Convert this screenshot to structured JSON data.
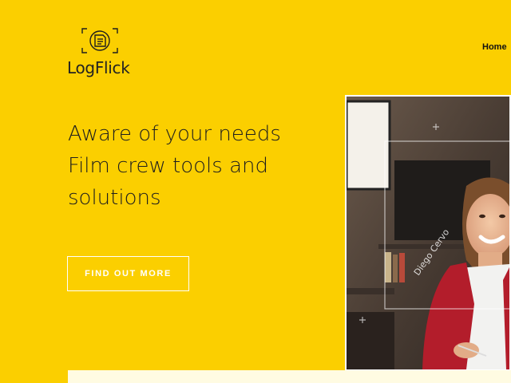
{
  "brand": {
    "name": "LogFlick",
    "logo_icon": "camera-document-icon"
  },
  "nav": {
    "items": [
      {
        "label": "Home"
      }
    ]
  },
  "hero": {
    "lines": [
      "Aware of your needs",
      "Film crew tools and",
      "solutions"
    ],
    "cta_label": "FIND OUT MORE",
    "image": {
      "watermark": "Diego Cervo",
      "subject": "smiling woman in red blazer in film studio"
    }
  },
  "colors": {
    "background": "#fbcf00",
    "text": "#1e1e1e",
    "button_border": "#ffffff",
    "panel": "#fffbe2"
  }
}
